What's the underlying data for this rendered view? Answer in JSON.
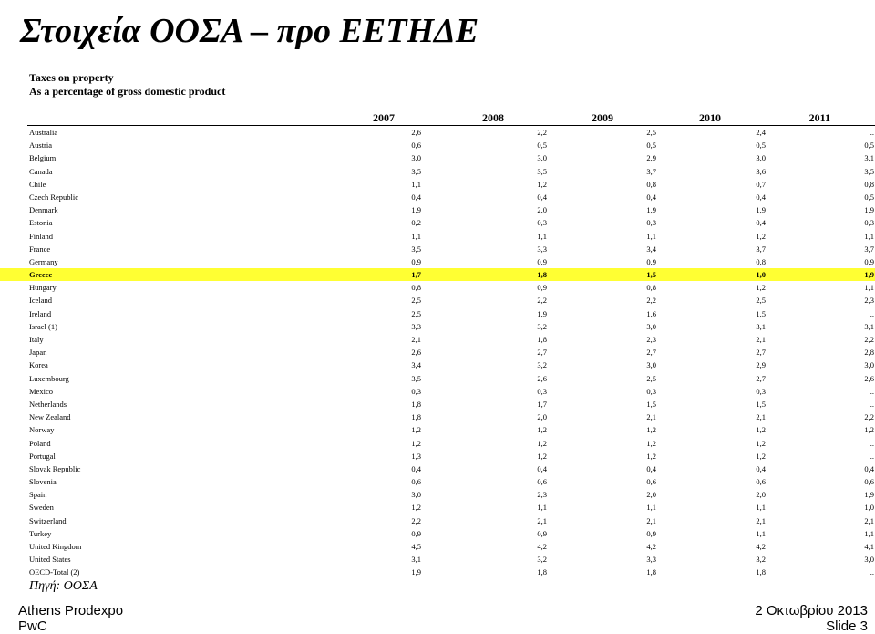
{
  "slide": {
    "title": "Στοιχεία ΟΟΣΑ – προ ΕΕΤΗΔΕ",
    "subtitle1": "Taxes on property",
    "subtitle2": "As a percentage of gross domestic product",
    "source": "Πηγή: ΟΟΣΑ"
  },
  "footer": {
    "left_line1": "Athens Prodexpo",
    "left_line2": "PwC",
    "right_line1": "2 Οκτωβρίου 2013",
    "right_line2": "Slide 3"
  },
  "table": {
    "years": [
      "2007",
      "2008",
      "2009",
      "2010",
      "2011"
    ],
    "highlight_color": "#ffff33",
    "rows": [
      {
        "name": "Australia",
        "values": [
          "2,6",
          "2,2",
          "2,5",
          "2,4",
          ".."
        ]
      },
      {
        "name": "Austria",
        "values": [
          "0,6",
          "0,5",
          "0,5",
          "0,5",
          "0,5"
        ]
      },
      {
        "name": "Belgium",
        "values": [
          "3,0",
          "3,0",
          "2,9",
          "3,0",
          "3,1"
        ]
      },
      {
        "name": "Canada",
        "values": [
          "3,5",
          "3,5",
          "3,7",
          "3,6",
          "3,5"
        ]
      },
      {
        "name": "Chile",
        "values": [
          "1,1",
          "1,2",
          "0,8",
          "0,7",
          "0,8"
        ]
      },
      {
        "name": "Czech Republic",
        "values": [
          "0,4",
          "0,4",
          "0,4",
          "0,4",
          "0,5"
        ]
      },
      {
        "name": "Denmark",
        "values": [
          "1,9",
          "2,0",
          "1,9",
          "1,9",
          "1,9"
        ]
      },
      {
        "name": "Estonia",
        "values": [
          "0,2",
          "0,3",
          "0,3",
          "0,4",
          "0,3"
        ]
      },
      {
        "name": "Finland",
        "values": [
          "1,1",
          "1,1",
          "1,1",
          "1,2",
          "1,1"
        ]
      },
      {
        "name": "France",
        "values": [
          "3,5",
          "3,3",
          "3,4",
          "3,7",
          "3,7"
        ]
      },
      {
        "name": "Germany",
        "values": [
          "0,9",
          "0,9",
          "0,9",
          "0,8",
          "0,9"
        ]
      },
      {
        "name": "Greece",
        "values": [
          "1,7",
          "1,8",
          "1,5",
          "1,0",
          "1,9"
        ],
        "highlight": true
      },
      {
        "name": "Hungary",
        "values": [
          "0,8",
          "0,9",
          "0,8",
          "1,2",
          "1,1"
        ]
      },
      {
        "name": "Iceland",
        "values": [
          "2,5",
          "2,2",
          "2,2",
          "2,5",
          "2,3"
        ]
      },
      {
        "name": "Ireland",
        "values": [
          "2,5",
          "1,9",
          "1,6",
          "1,5",
          ".."
        ]
      },
      {
        "name": "Israel (1)",
        "values": [
          "3,3",
          "3,2",
          "3,0",
          "3,1",
          "3,1"
        ]
      },
      {
        "name": "Italy",
        "values": [
          "2,1",
          "1,8",
          "2,3",
          "2,1",
          "2,2"
        ]
      },
      {
        "name": "Japan",
        "values": [
          "2,6",
          "2,7",
          "2,7",
          "2,7",
          "2,8"
        ]
      },
      {
        "name": "Korea",
        "values": [
          "3,4",
          "3,2",
          "3,0",
          "2,9",
          "3,0"
        ]
      },
      {
        "name": "Luxembourg",
        "values": [
          "3,5",
          "2,6",
          "2,5",
          "2,7",
          "2,6"
        ]
      },
      {
        "name": "Mexico",
        "values": [
          "0,3",
          "0,3",
          "0,3",
          "0,3",
          ".."
        ]
      },
      {
        "name": "Netherlands",
        "values": [
          "1,8",
          "1,7",
          "1,5",
          "1,5",
          ".."
        ]
      },
      {
        "name": "New Zealand",
        "values": [
          "1,8",
          "2,0",
          "2,1",
          "2,1",
          "2,2"
        ]
      },
      {
        "name": "Norway",
        "values": [
          "1,2",
          "1,2",
          "1,2",
          "1,2",
          "1,2"
        ]
      },
      {
        "name": "Poland",
        "values": [
          "1,2",
          "1,2",
          "1,2",
          "1,2",
          ".."
        ]
      },
      {
        "name": "Portugal",
        "values": [
          "1,3",
          "1,2",
          "1,2",
          "1,2",
          ".."
        ]
      },
      {
        "name": "Slovak Republic",
        "values": [
          "0,4",
          "0,4",
          "0,4",
          "0,4",
          "0,4"
        ]
      },
      {
        "name": "Slovenia",
        "values": [
          "0,6",
          "0,6",
          "0,6",
          "0,6",
          "0,6"
        ]
      },
      {
        "name": "Spain",
        "values": [
          "3,0",
          "2,3",
          "2,0",
          "2,0",
          "1,9"
        ]
      },
      {
        "name": "Sweden",
        "values": [
          "1,2",
          "1,1",
          "1,1",
          "1,1",
          "1,0"
        ]
      },
      {
        "name": "Switzerland",
        "values": [
          "2,2",
          "2,1",
          "2,1",
          "2,1",
          "2,1"
        ]
      },
      {
        "name": "Turkey",
        "values": [
          "0,9",
          "0,9",
          "0,9",
          "1,1",
          "1,1"
        ]
      },
      {
        "name": "United Kingdom",
        "values": [
          "4,5",
          "4,2",
          "4,2",
          "4,2",
          "4,1"
        ]
      },
      {
        "name": "United States",
        "values": [
          "3,1",
          "3,2",
          "3,3",
          "3,2",
          "3,0"
        ]
      },
      {
        "name": "OECD-Total (2)",
        "values": [
          "1,9",
          "1,8",
          "1,8",
          "1,8",
          ".."
        ]
      }
    ]
  }
}
